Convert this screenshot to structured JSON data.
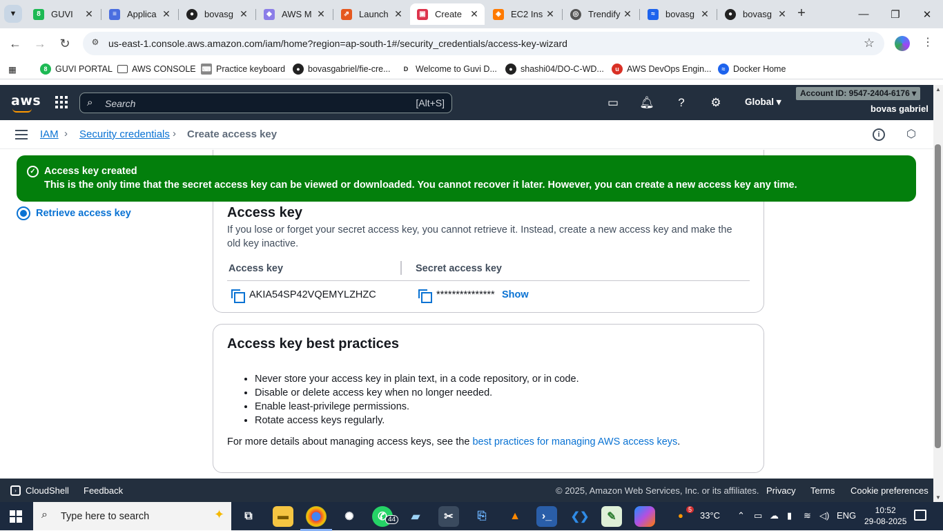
{
  "browser": {
    "tabs": [
      {
        "title": "GUVI",
        "icon": "guvi-icon",
        "color": "#1db954"
      },
      {
        "title": "Applica",
        "icon": "docs-icon",
        "color": "#4a6ee0"
      },
      {
        "title": "bovasg",
        "icon": "github-icon",
        "color": "#222222"
      },
      {
        "title": "AWS M",
        "icon": "cube-icon",
        "color": "#8b7de8"
      },
      {
        "title": "Launch",
        "icon": "launch-icon",
        "color": "#e5581f"
      },
      {
        "title": "Create",
        "icon": "aws-red-icon",
        "color": "#dd344c"
      },
      {
        "title": "EC2 Ins",
        "icon": "ec2-icon",
        "color": "#ff7a00"
      },
      {
        "title": "Trendify",
        "icon": "globe-icon",
        "color": "#555555"
      },
      {
        "title": "bovasg",
        "icon": "docker-icon",
        "color": "#1d63ed"
      },
      {
        "title": "bovasg",
        "icon": "github-icon",
        "color": "#222222"
      }
    ],
    "url": "us-east-1.console.aws.amazon.com/iam/home?region=ap-south-1#/security_credentials/access-key-wizard",
    "bookmarks": [
      {
        "label": "GUVI PORTAL",
        "icon": "guvi-icon",
        "color": "#1db954"
      },
      {
        "label": "AWS CONSOLE",
        "icon": "folder-icon",
        "color": "#444444"
      },
      {
        "label": "Practice keyboard",
        "icon": "keyboard-icon",
        "color": "#666666"
      },
      {
        "label": "bovasgabriel/fie-cre...",
        "icon": "github-icon",
        "color": "#222222"
      },
      {
        "label": "Welcome to Guvi D...",
        "icon": "d-icon",
        "color": "#ffffff"
      },
      {
        "label": "shashi04/DO-C-WD...",
        "icon": "github-icon",
        "color": "#222222"
      },
      {
        "label": "AWS DevOps Engin...",
        "icon": "upwork-icon",
        "color": "#d93025"
      },
      {
        "label": "Docker Home",
        "icon": "docker-icon",
        "color": "#1d63ed"
      }
    ]
  },
  "aws": {
    "search_placeholder": "Search",
    "search_shortcut": "[Alt+S]",
    "region": "Global",
    "account": "Account ID: 9547-2404-6176",
    "user": "bovas gabriel",
    "breadcrumbs": [
      "IAM",
      "Security credentials",
      "Create access key"
    ],
    "step_label": "Retrieve access key",
    "flash": {
      "title": "Access key created",
      "message": "This is the only time that the secret access key can be viewed or downloaded. You cannot recover it later. However, you can create a new access key any time."
    },
    "access_key_panel": {
      "title": "Access key",
      "description": "If you lose or forget your secret access key, you cannot retrieve it. Instead, create a new access key and make the old key inactive.",
      "col_access": "Access key",
      "col_secret": "Secret access key",
      "access_key_value": "AKIA54SP42VQEMYLZHZC",
      "secret_masked": "***************",
      "show_label": "Show"
    },
    "best_practices": {
      "title": "Access key best practices",
      "items": [
        "Never store your access key in plain text, in a code repository, or in code.",
        "Disable or delete access key when no longer needed.",
        "Enable least-privilege permissions.",
        "Rotate access keys regularly."
      ],
      "more_prefix": "For more details about managing access keys, see the ",
      "more_link": "best practices for managing AWS access keys",
      "more_suffix": "."
    },
    "footer": {
      "cloudshell": "CloudShell",
      "feedback": "Feedback",
      "copyright": "© 2025, Amazon Web Services, Inc. or its affiliates.",
      "privacy": "Privacy",
      "terms": "Terms",
      "cookies": "Cookie preferences"
    }
  },
  "taskbar": {
    "search_placeholder": "Type here to search",
    "whatsapp_badge": "44",
    "weather": "33°C",
    "weather_badge": "5",
    "language": "ENG",
    "time": "10:52",
    "date": "29-08-2025"
  }
}
